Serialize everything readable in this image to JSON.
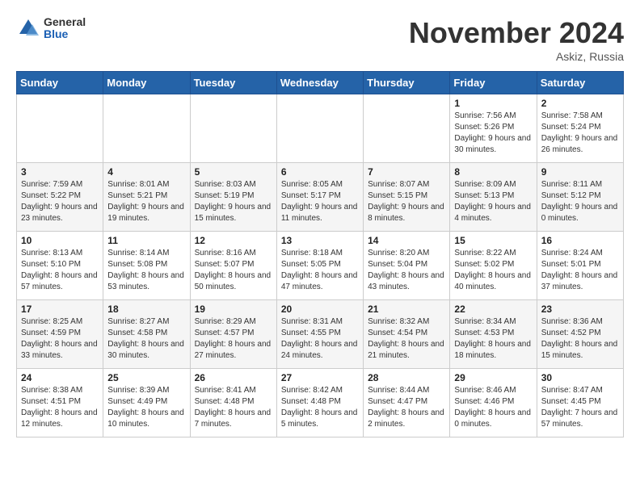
{
  "header": {
    "logo_general": "General",
    "logo_blue": "Blue",
    "month": "November 2024",
    "location": "Askiz, Russia"
  },
  "weekdays": [
    "Sunday",
    "Monday",
    "Tuesday",
    "Wednesday",
    "Thursday",
    "Friday",
    "Saturday"
  ],
  "weeks": [
    [
      {
        "day": "",
        "info": ""
      },
      {
        "day": "",
        "info": ""
      },
      {
        "day": "",
        "info": ""
      },
      {
        "day": "",
        "info": ""
      },
      {
        "day": "",
        "info": ""
      },
      {
        "day": "1",
        "info": "Sunrise: 7:56 AM\nSunset: 5:26 PM\nDaylight: 9 hours and 30 minutes."
      },
      {
        "day": "2",
        "info": "Sunrise: 7:58 AM\nSunset: 5:24 PM\nDaylight: 9 hours and 26 minutes."
      }
    ],
    [
      {
        "day": "3",
        "info": "Sunrise: 7:59 AM\nSunset: 5:22 PM\nDaylight: 9 hours and 23 minutes."
      },
      {
        "day": "4",
        "info": "Sunrise: 8:01 AM\nSunset: 5:21 PM\nDaylight: 9 hours and 19 minutes."
      },
      {
        "day": "5",
        "info": "Sunrise: 8:03 AM\nSunset: 5:19 PM\nDaylight: 9 hours and 15 minutes."
      },
      {
        "day": "6",
        "info": "Sunrise: 8:05 AM\nSunset: 5:17 PM\nDaylight: 9 hours and 11 minutes."
      },
      {
        "day": "7",
        "info": "Sunrise: 8:07 AM\nSunset: 5:15 PM\nDaylight: 9 hours and 8 minutes."
      },
      {
        "day": "8",
        "info": "Sunrise: 8:09 AM\nSunset: 5:13 PM\nDaylight: 9 hours and 4 minutes."
      },
      {
        "day": "9",
        "info": "Sunrise: 8:11 AM\nSunset: 5:12 PM\nDaylight: 9 hours and 0 minutes."
      }
    ],
    [
      {
        "day": "10",
        "info": "Sunrise: 8:13 AM\nSunset: 5:10 PM\nDaylight: 8 hours and 57 minutes."
      },
      {
        "day": "11",
        "info": "Sunrise: 8:14 AM\nSunset: 5:08 PM\nDaylight: 8 hours and 53 minutes."
      },
      {
        "day": "12",
        "info": "Sunrise: 8:16 AM\nSunset: 5:07 PM\nDaylight: 8 hours and 50 minutes."
      },
      {
        "day": "13",
        "info": "Sunrise: 8:18 AM\nSunset: 5:05 PM\nDaylight: 8 hours and 47 minutes."
      },
      {
        "day": "14",
        "info": "Sunrise: 8:20 AM\nSunset: 5:04 PM\nDaylight: 8 hours and 43 minutes."
      },
      {
        "day": "15",
        "info": "Sunrise: 8:22 AM\nSunset: 5:02 PM\nDaylight: 8 hours and 40 minutes."
      },
      {
        "day": "16",
        "info": "Sunrise: 8:24 AM\nSunset: 5:01 PM\nDaylight: 8 hours and 37 minutes."
      }
    ],
    [
      {
        "day": "17",
        "info": "Sunrise: 8:25 AM\nSunset: 4:59 PM\nDaylight: 8 hours and 33 minutes."
      },
      {
        "day": "18",
        "info": "Sunrise: 8:27 AM\nSunset: 4:58 PM\nDaylight: 8 hours and 30 minutes."
      },
      {
        "day": "19",
        "info": "Sunrise: 8:29 AM\nSunset: 4:57 PM\nDaylight: 8 hours and 27 minutes."
      },
      {
        "day": "20",
        "info": "Sunrise: 8:31 AM\nSunset: 4:55 PM\nDaylight: 8 hours and 24 minutes."
      },
      {
        "day": "21",
        "info": "Sunrise: 8:32 AM\nSunset: 4:54 PM\nDaylight: 8 hours and 21 minutes."
      },
      {
        "day": "22",
        "info": "Sunrise: 8:34 AM\nSunset: 4:53 PM\nDaylight: 8 hours and 18 minutes."
      },
      {
        "day": "23",
        "info": "Sunrise: 8:36 AM\nSunset: 4:52 PM\nDaylight: 8 hours and 15 minutes."
      }
    ],
    [
      {
        "day": "24",
        "info": "Sunrise: 8:38 AM\nSunset: 4:51 PM\nDaylight: 8 hours and 12 minutes."
      },
      {
        "day": "25",
        "info": "Sunrise: 8:39 AM\nSunset: 4:49 PM\nDaylight: 8 hours and 10 minutes."
      },
      {
        "day": "26",
        "info": "Sunrise: 8:41 AM\nSunset: 4:48 PM\nDaylight: 8 hours and 7 minutes."
      },
      {
        "day": "27",
        "info": "Sunrise: 8:42 AM\nSunset: 4:48 PM\nDaylight: 8 hours and 5 minutes."
      },
      {
        "day": "28",
        "info": "Sunrise: 8:44 AM\nSunset: 4:47 PM\nDaylight: 8 hours and 2 minutes."
      },
      {
        "day": "29",
        "info": "Sunrise: 8:46 AM\nSunset: 4:46 PM\nDaylight: 8 hours and 0 minutes."
      },
      {
        "day": "30",
        "info": "Sunrise: 8:47 AM\nSunset: 4:45 PM\nDaylight: 7 hours and 57 minutes."
      }
    ]
  ]
}
